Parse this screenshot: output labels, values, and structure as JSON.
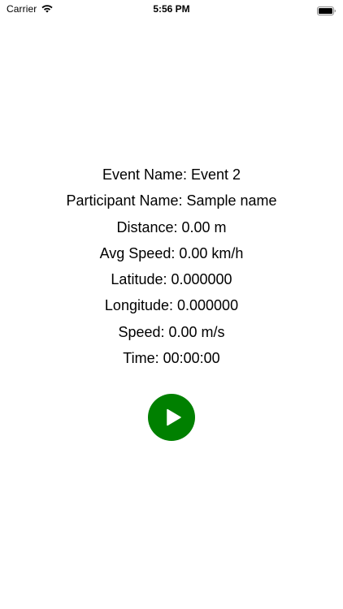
{
  "status_bar": {
    "carrier": "Carrier",
    "time": "5:56 PM",
    "wifi_icon": "wifi-icon",
    "battery_icon": "battery-full-icon"
  },
  "tracking": {
    "event_name": "Event Name: Event 2",
    "participant_name": "Participant Name: Sample name",
    "distance": "Distance: 0.00 m",
    "avg_speed": "Avg Speed: 0.00 km/h",
    "latitude": "Latitude: 0.000000",
    "longitude": "Longitude: 0.000000",
    "speed": "Speed: 0.00 m/s",
    "time": "Time: 00:00:00"
  },
  "controls": {
    "play_icon": "play-icon",
    "play_color": "#008000"
  }
}
